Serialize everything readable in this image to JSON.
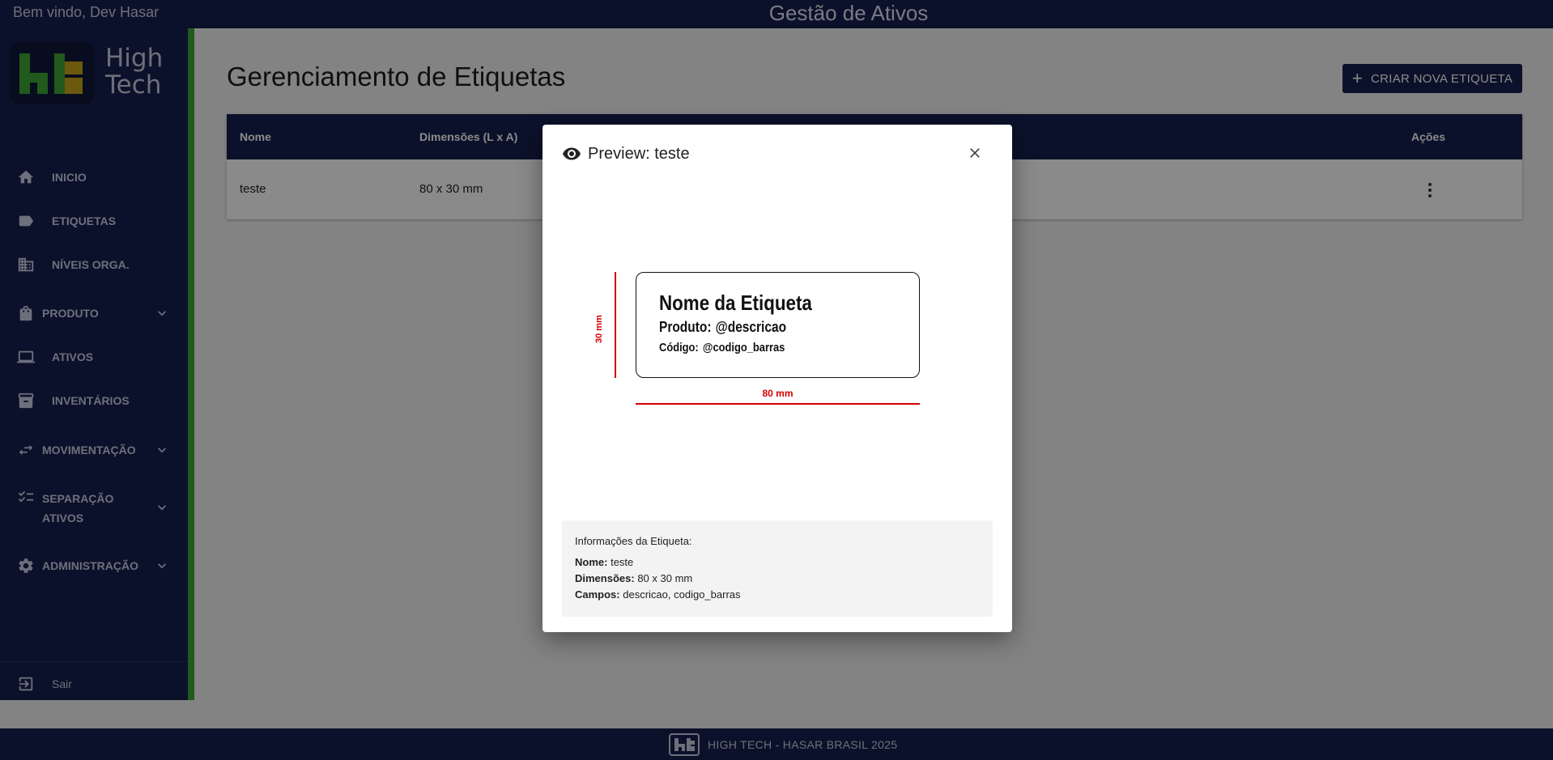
{
  "header": {
    "welcome": "Bem vindo, Dev Hasar",
    "app_title": "Gestão de Ativos"
  },
  "brand": {
    "logo_text": "High Tech",
    "logo_line1": "High",
    "logo_line2": "Tech",
    "accent_color": "#3fa535",
    "primary_color": "#16214f"
  },
  "sidebar": {
    "items": [
      {
        "label": "INICIO",
        "icon": "home-icon"
      },
      {
        "label": "ETIQUETAS",
        "icon": "label-icon"
      },
      {
        "label": "NÍVEIS ORGA.",
        "icon": "building-icon"
      },
      {
        "label": "PRODUTO",
        "icon": "bag-icon",
        "expandable": true
      },
      {
        "label": "ATIVOS",
        "icon": "laptop-icon"
      },
      {
        "label": "INVENTÁRIOS",
        "icon": "archive-icon"
      },
      {
        "label": "MOVIMENTAÇÃO",
        "icon": "swap-icon",
        "expandable": true
      },
      {
        "label": "SEPARAÇÃO ATIVOS",
        "line1": "SEPARAÇÃO",
        "line2": "ATIVOS",
        "icon": "checklist-icon",
        "expandable": true
      },
      {
        "label": "ADMINISTRAÇÃO",
        "icon": "gear-icon",
        "expandable": true
      }
    ],
    "logout": {
      "label": "Sair",
      "icon": "logout-icon"
    }
  },
  "main": {
    "title": "Gerenciamento de Etiquetas",
    "create_button": "CRIAR NOVA ETIQUETA",
    "table": {
      "columns": [
        "Nome",
        "Dimensões (L x A)",
        "Ações"
      ],
      "rows": [
        {
          "nome": "teste",
          "dimensoes": "80 x 30 mm"
        }
      ]
    }
  },
  "modal": {
    "title": "Preview: teste",
    "label_preview": {
      "title": "Nome da Etiqueta",
      "produto_key": "Produto:",
      "produto_value": "@descricao",
      "codigo_key": "Código:",
      "codigo_value": "@codigo_barras",
      "height_label": "30 mm",
      "width_label": "80 mm"
    },
    "info": {
      "heading": "Informações da Etiqueta:",
      "nome_key": "Nome:",
      "nome_value": "teste",
      "dim_key": "Dimensões:",
      "dim_value": "80 x 30 mm",
      "campos_key": "Campos:",
      "campos_value": "descricao, codigo_barras"
    }
  },
  "footer": {
    "text": "HIGH TECH - HASAR BRASIL 2025"
  }
}
